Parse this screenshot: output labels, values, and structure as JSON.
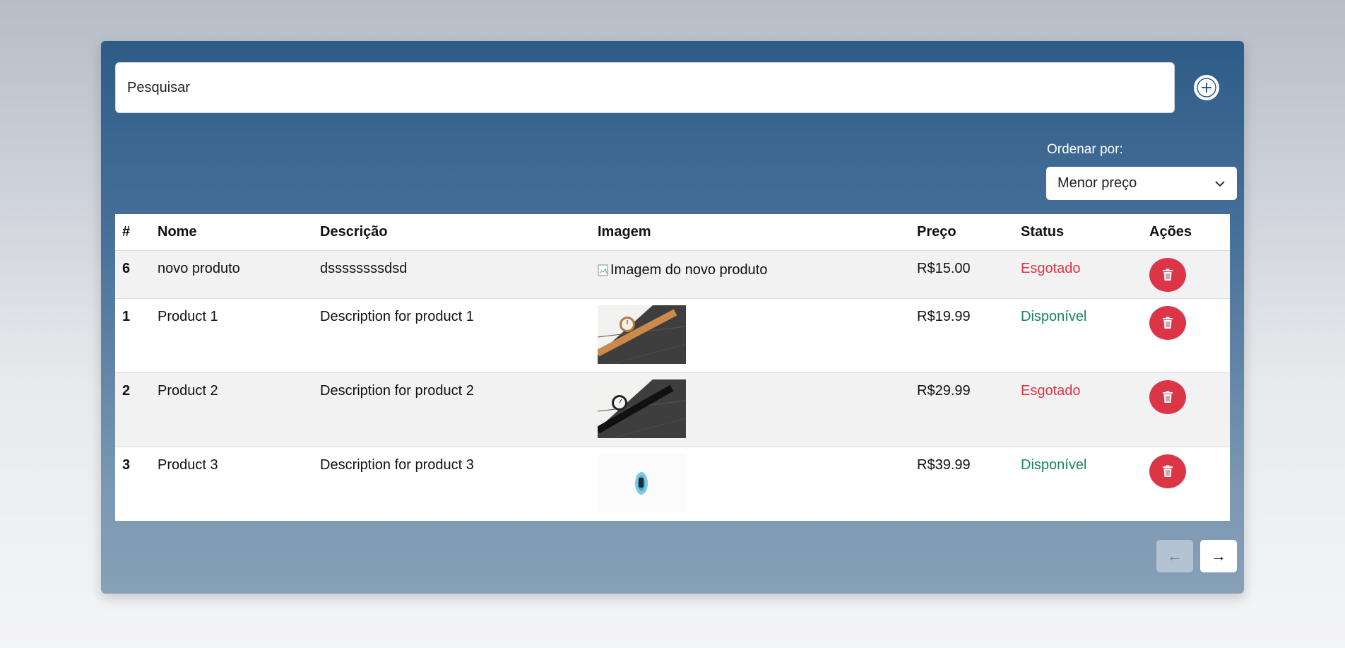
{
  "search": {
    "placeholder": "Pesquisar"
  },
  "add_button": {
    "icon": "plus-circle-icon"
  },
  "sort": {
    "label": "Ordenar por:",
    "selected": "Menor preço"
  },
  "table": {
    "headers": {
      "num": "#",
      "name": "Nome",
      "description": "Descrição",
      "image": "Imagem",
      "price": "Preço",
      "status": "Status",
      "actions": "Ações"
    },
    "rows": [
      {
        "id": "6",
        "name": "novo produto",
        "description": "dssssssssdsd",
        "image_alt": "Imagem do novo produto",
        "image": "broken",
        "price": "R$15.00",
        "status": "Esgotado"
      },
      {
        "id": "1",
        "name": "Product 1",
        "description": "Description for product 1",
        "image": "watch-brown-strap",
        "price": "R$19.99",
        "status": "Disponível"
      },
      {
        "id": "2",
        "name": "Product 2",
        "description": "Description for product 2",
        "image": "watch-black-strap",
        "price": "R$29.99",
        "status": "Esgotado"
      },
      {
        "id": "3",
        "name": "Product 3",
        "description": "Description for product 3",
        "image": "fitness-band-blue",
        "price": "R$39.99",
        "status": "Disponível"
      }
    ]
  },
  "pagination": {
    "prev_label": "←",
    "next_label": "→"
  },
  "colors": {
    "danger": "#dc3545",
    "success": "#198754",
    "panel_top": "#2f5c87"
  }
}
